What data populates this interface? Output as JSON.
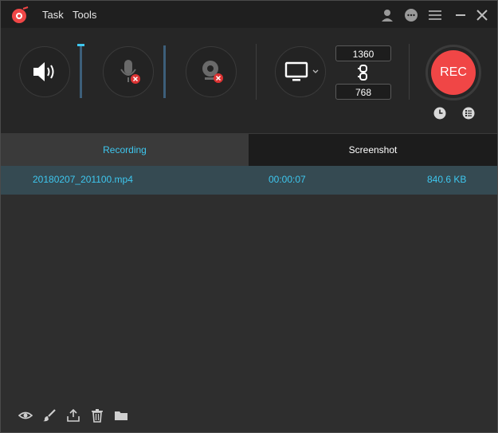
{
  "menu": {
    "task": "Task",
    "tools": "Tools"
  },
  "dimensions": {
    "width": "1360",
    "height": "768"
  },
  "rec_label": "REC",
  "tabs": {
    "recording": "Recording",
    "screenshot": "Screenshot"
  },
  "list": [
    {
      "filename": "20180207_201100.mp4",
      "duration": "00:00:07",
      "size": "840.6 KB"
    }
  ],
  "colors": {
    "accent": "#3ec7ef",
    "rec": "#f04646"
  },
  "icons": [
    "app-logo-icon",
    "user-icon",
    "chat-icon",
    "menu-icon",
    "minimize-icon",
    "close-icon",
    "speaker-icon",
    "microphone-icon",
    "webcam-icon",
    "monitor-icon",
    "chevron-down-icon",
    "link-icon",
    "clock-icon",
    "list-icon",
    "eye-icon",
    "brush-icon",
    "share-icon",
    "trash-icon",
    "folder-icon"
  ]
}
